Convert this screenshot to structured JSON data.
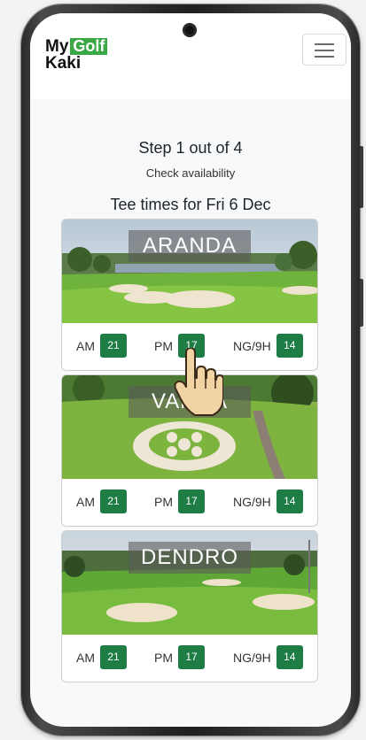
{
  "app": {
    "logo_line1_text": "My",
    "logo_line1_highlight": "Golf",
    "logo_line2": "Kaki",
    "menu_icon": "hamburger-icon"
  },
  "step": {
    "title": "Step 1 out of 4",
    "subtitle": "Check availability"
  },
  "tee_times_title": "Tee times for Fri 6 Dec",
  "courses": [
    {
      "name": "ARANDA",
      "am_label": "AM",
      "am_count": "21",
      "pm_label": "PM",
      "pm_count": "17",
      "ng_label": "NG/9H",
      "ng_count": "14"
    },
    {
      "name": "VANDA",
      "am_label": "AM",
      "am_count": "21",
      "pm_label": "PM",
      "pm_count": "17",
      "ng_label": "NG/9H",
      "ng_count": "14"
    },
    {
      "name": "DENDRO",
      "am_label": "AM",
      "am_count": "21",
      "pm_label": "PM",
      "pm_count": "17",
      "ng_label": "NG/9H",
      "ng_count": "14"
    }
  ],
  "colors": {
    "brand_green": "#3aa845",
    "badge_green": "#1e7c45"
  },
  "overlay_icon": "pointing-hand-icon"
}
